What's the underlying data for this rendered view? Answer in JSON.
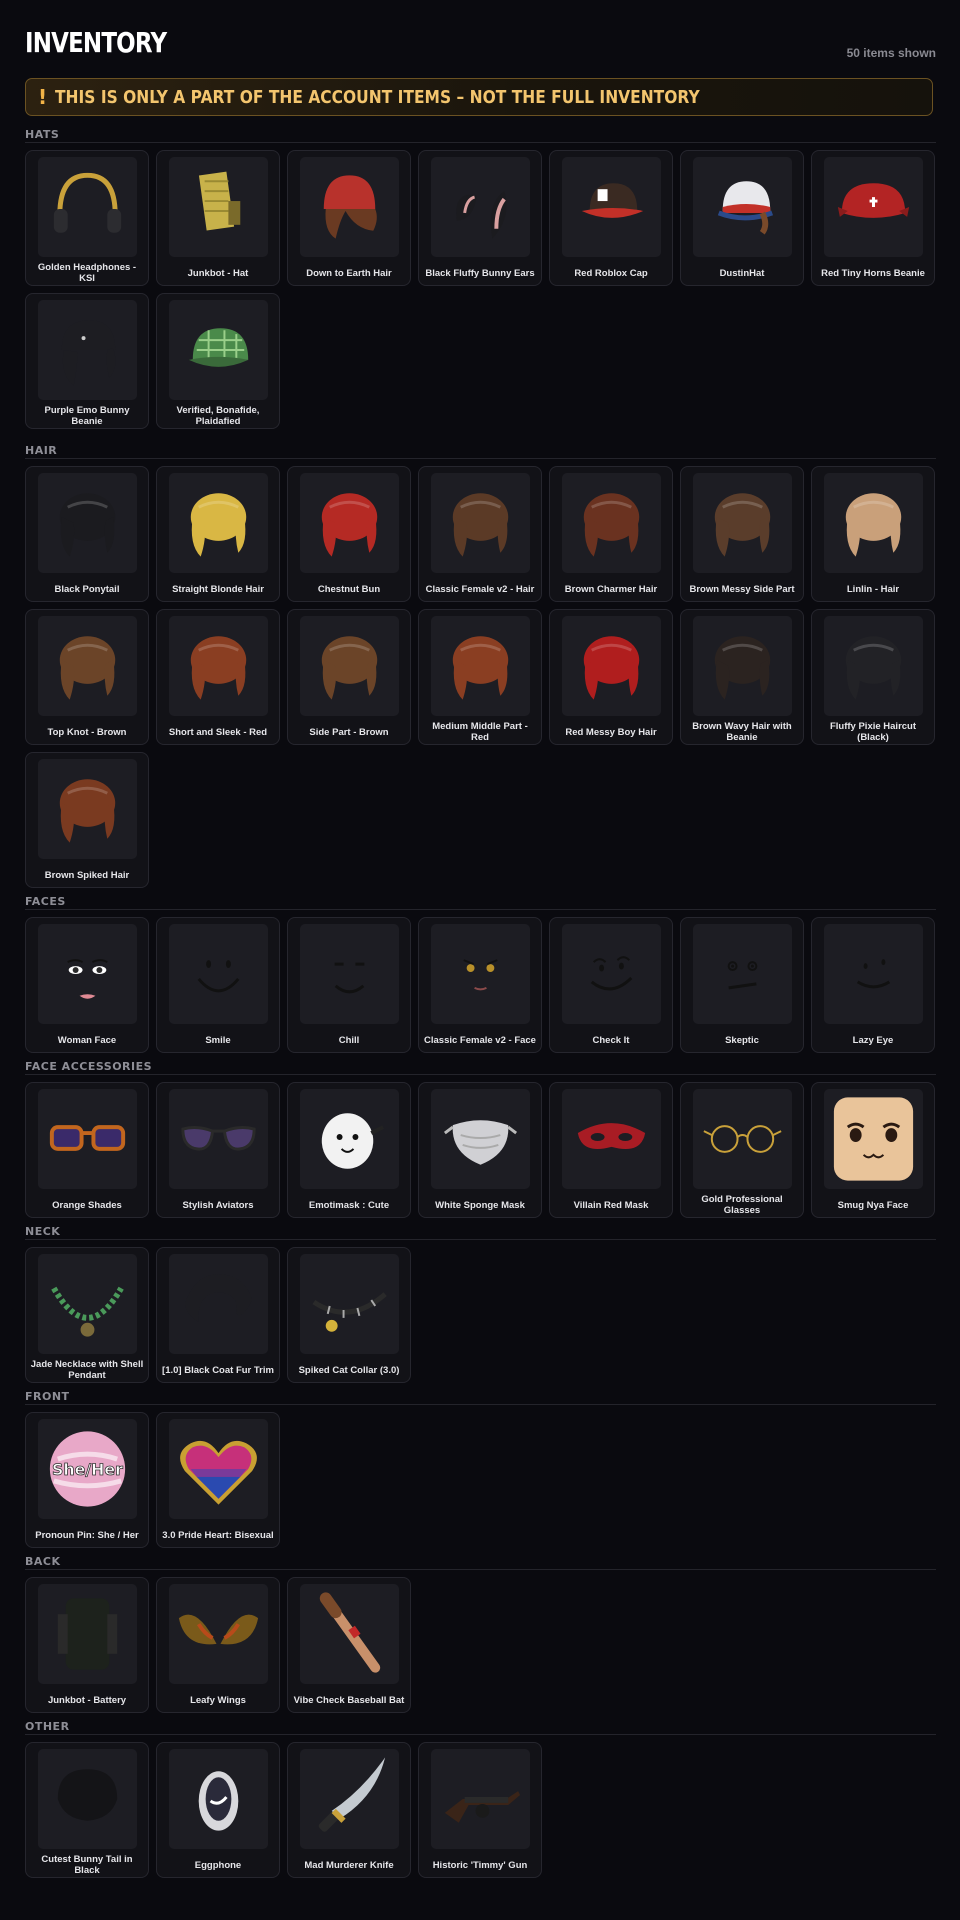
{
  "header": {
    "title": "INVENTORY",
    "count": "50 items shown"
  },
  "banner": {
    "icon": "!",
    "text": "THIS IS ONLY A PART OF THE ACCOUNT ITEMS – NOT THE FULL INVENTORY"
  },
  "sections": [
    {
      "title": "HATS",
      "items": [
        {
          "name": "Golden Headphones - KSI",
          "icon": "headphones-icon"
        },
        {
          "name": "Junkbot - Hat",
          "icon": "junkbot-hat-icon"
        },
        {
          "name": "Down to Earth Hair",
          "icon": "beanie-hair-icon"
        },
        {
          "name": "Black Fluffy Bunny Ears",
          "icon": "bunny-ears-icon"
        },
        {
          "name": "Red Roblox Cap",
          "icon": "red-cap-icon"
        },
        {
          "name": "DustinHat",
          "icon": "trucker-hat-icon"
        },
        {
          "name": "Red Tiny Horns Beanie",
          "icon": "red-beanie-icon"
        },
        {
          "name": "Purple Emo Bunny Beanie",
          "icon": "emo-beanie-icon"
        },
        {
          "name": "Verified, Bonafide, Plaidafied",
          "icon": "plaid-cap-icon"
        }
      ]
    },
    {
      "title": "HAIR",
      "items": [
        {
          "name": "Black Ponytail",
          "icon": "hair-icon"
        },
        {
          "name": "Straight Blonde Hair",
          "icon": "hair-icon"
        },
        {
          "name": "Chestnut Bun",
          "icon": "hair-icon"
        },
        {
          "name": "Classic Female v2 - Hair",
          "icon": "hair-icon"
        },
        {
          "name": "Brown Charmer Hair",
          "icon": "hair-icon"
        },
        {
          "name": "Brown Messy Side Part",
          "icon": "hair-icon"
        },
        {
          "name": "Linlin - Hair",
          "icon": "hair-icon"
        },
        {
          "name": "Top Knot - Brown",
          "icon": "hair-icon"
        },
        {
          "name": "Short and Sleek - Red",
          "icon": "hair-icon"
        },
        {
          "name": "Side Part - Brown",
          "icon": "hair-icon"
        },
        {
          "name": "Medium Middle Part - Red",
          "icon": "hair-icon"
        },
        {
          "name": "Red Messy Boy Hair",
          "icon": "hair-icon"
        },
        {
          "name": "Brown Wavy Hair with Beanie",
          "icon": "hair-icon"
        },
        {
          "name": "Fluffy Pixie Haircut (Black)",
          "icon": "hair-icon"
        },
        {
          "name": "Brown Spiked Hair",
          "icon": "hair-icon"
        }
      ]
    },
    {
      "title": "FACES",
      "items": [
        {
          "name": "Woman Face",
          "icon": "face-icon"
        },
        {
          "name": "Smile",
          "icon": "face-icon"
        },
        {
          "name": "Chill",
          "icon": "face-icon"
        },
        {
          "name": "Classic Female v2 - Face",
          "icon": "face-icon"
        },
        {
          "name": "Check It",
          "icon": "face-icon"
        },
        {
          "name": "Skeptic",
          "icon": "face-icon"
        },
        {
          "name": "Lazy Eye",
          "icon": "face-icon"
        }
      ]
    },
    {
      "title": "FACE ACCESSORIES",
      "items": [
        {
          "name": "Orange Shades",
          "icon": "sunglasses-icon"
        },
        {
          "name": "Stylish Aviators",
          "icon": "aviators-icon"
        },
        {
          "name": "Emotimask : Cute",
          "icon": "mask-icon"
        },
        {
          "name": "White Sponge Mask",
          "icon": "face-mask-icon"
        },
        {
          "name": "Villain Red Mask",
          "icon": "eye-mask-icon"
        },
        {
          "name": "Gold Professional Glasses",
          "icon": "glasses-icon"
        },
        {
          "name": "Smug Nya Face",
          "icon": "head-icon"
        }
      ]
    },
    {
      "title": "NECK",
      "items": [
        {
          "name": "Jade Necklace with Shell Pendant",
          "icon": "necklace-icon"
        },
        {
          "name": "[1.0] Black Coat Fur Trim",
          "icon": "fur-trim-icon"
        },
        {
          "name": "Spiked Cat Collar (3.0)",
          "icon": "collar-icon"
        }
      ]
    },
    {
      "title": "FRONT",
      "items": [
        {
          "name": "Pronoun Pin: She / Her",
          "icon": "pin-icon",
          "badge": "She/Her"
        },
        {
          "name": "3.0 Pride Heart: Bisexual",
          "icon": "heart-pin-icon"
        }
      ]
    },
    {
      "title": "BACK",
      "items": [
        {
          "name": "Junkbot - Battery",
          "icon": "battery-icon"
        },
        {
          "name": "Leafy Wings",
          "icon": "wings-icon"
        },
        {
          "name": "Vibe Check Baseball Bat",
          "icon": "bat-icon"
        }
      ]
    },
    {
      "title": "OTHER",
      "items": [
        {
          "name": "Cutest Bunny Tail in Black",
          "icon": "tail-icon"
        },
        {
          "name": "Eggphone",
          "icon": "phone-icon"
        },
        {
          "name": "Mad Murderer Knife",
          "icon": "knife-icon"
        },
        {
          "name": "Historic 'Timmy' Gun",
          "icon": "gun-icon"
        }
      ]
    }
  ]
}
